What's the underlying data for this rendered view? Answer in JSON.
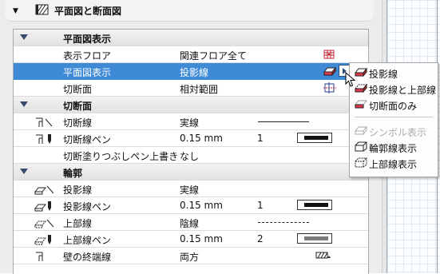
{
  "section": {
    "title": "平面図と断面図"
  },
  "groups": [
    {
      "label": "平面図表示"
    },
    {
      "label": "切断面"
    },
    {
      "label": "輪郭"
    }
  ],
  "rows": [
    {
      "label": "表示フロア",
      "value": "関連フロア全て"
    },
    {
      "label": "平面図表示",
      "value": "投影線"
    },
    {
      "label": "切断面",
      "value": "相対範囲"
    },
    {
      "label": "切断線",
      "value": "実線"
    },
    {
      "label": "切断線ペン",
      "value": "0.15 mm",
      "num": "1"
    },
    {
      "label": "切断塗りつぶしペン上書き",
      "value": "なし"
    },
    {
      "label": "投影線",
      "value": "実線"
    },
    {
      "label": "投影線ペン",
      "value": "0.15 mm",
      "num": "1"
    },
    {
      "label": "上部線",
      "value": "陰線"
    },
    {
      "label": "上部線ペン",
      "value": "0.15 mm",
      "num": "2"
    },
    {
      "label": "壁の終端線",
      "value": "両方"
    }
  ],
  "popup": {
    "items": [
      {
        "label": "投影線",
        "icon": "projection-icon"
      },
      {
        "label": "投影線と上部線",
        "icon": "projection-overhead-icon"
      },
      {
        "label": "切断面のみ",
        "icon": "cut-only-icon"
      },
      {
        "label": "シンボル表示",
        "icon": "symbolic-icon",
        "disabled": true
      },
      {
        "label": "輪郭線表示",
        "icon": "outline-icon"
      },
      {
        "label": "上部線表示",
        "icon": "overhead-all-icon"
      }
    ]
  },
  "colors": {
    "selection": "#3f8ad6",
    "accent_red": "#d9323f",
    "group_triangle": "#3a4b6e"
  }
}
